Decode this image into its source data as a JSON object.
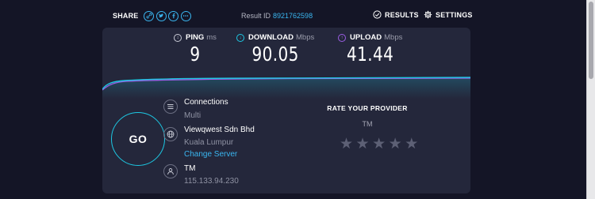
{
  "topbar": {
    "share_label": "SHARE",
    "share_icons": [
      "link-icon",
      "twitter-icon",
      "facebook-icon",
      "more-icon"
    ],
    "result_id_label": "Result ID",
    "result_id": "8921762598",
    "results_label": "RESULTS",
    "settings_label": "SETTINGS"
  },
  "metrics": {
    "ping": {
      "label": "PING",
      "unit": "ms",
      "value": "9",
      "icon": "ping-icon"
    },
    "download": {
      "label": "DOWNLOAD",
      "unit": "Mbps",
      "value": "90.05",
      "icon": "download-arrow-icon"
    },
    "upload": {
      "label": "UPLOAD",
      "unit": "Mbps",
      "value": "41.44",
      "icon": "upload-arrow-icon"
    }
  },
  "go_label": "GO",
  "connections": {
    "label": "Connections",
    "value": "Multi"
  },
  "server": {
    "name": "Viewqwest Sdn Bhd",
    "location": "Kuala Lumpur",
    "change_label": "Change Server"
  },
  "provider": {
    "name": "TM",
    "ip": "115.133.94.230"
  },
  "rating": {
    "title": "RATE YOUR PROVIDER",
    "provider": "TM",
    "stars_total": 5,
    "stars_selected": 0
  },
  "colors": {
    "background": "#141526",
    "card": "#24273b",
    "accent": "#1dc8e3",
    "link": "#3ab6f0",
    "upload": "#9b5de5"
  }
}
